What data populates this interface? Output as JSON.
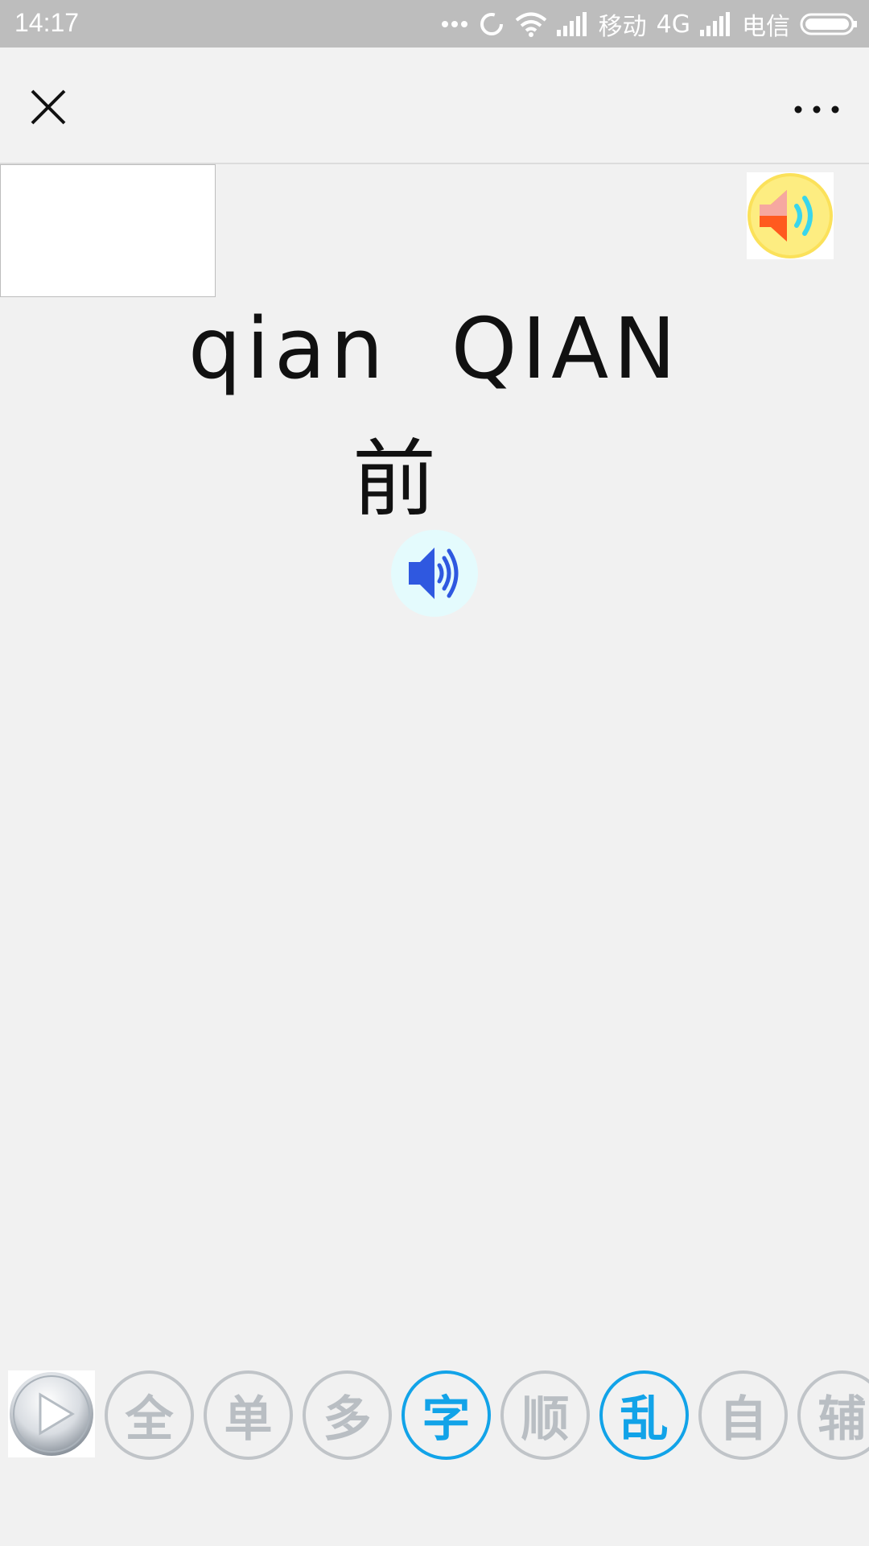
{
  "status_bar": {
    "time": "14:17",
    "carrier1": "移动",
    "network": "4G",
    "carrier2": "电信"
  },
  "nav": {
    "close_icon": "close-icon",
    "more_icon": "more-icon"
  },
  "word": {
    "pinyin": "qian  QIAN",
    "hanzi": "前"
  },
  "bottom_buttons": [
    {
      "label": "全",
      "active": false
    },
    {
      "label": "单",
      "active": false
    },
    {
      "label": "多",
      "active": false
    },
    {
      "label": "字",
      "active": true
    },
    {
      "label": "顺",
      "active": false
    },
    {
      "label": "乱",
      "active": true
    },
    {
      "label": "自",
      "active": false
    },
    {
      "label": "辅",
      "active": false
    }
  ],
  "colors": {
    "accent": "#12a3e8",
    "inactive": "#b9bec3",
    "status_bar": "#bdbdbd",
    "background": "#f1f1f1"
  }
}
